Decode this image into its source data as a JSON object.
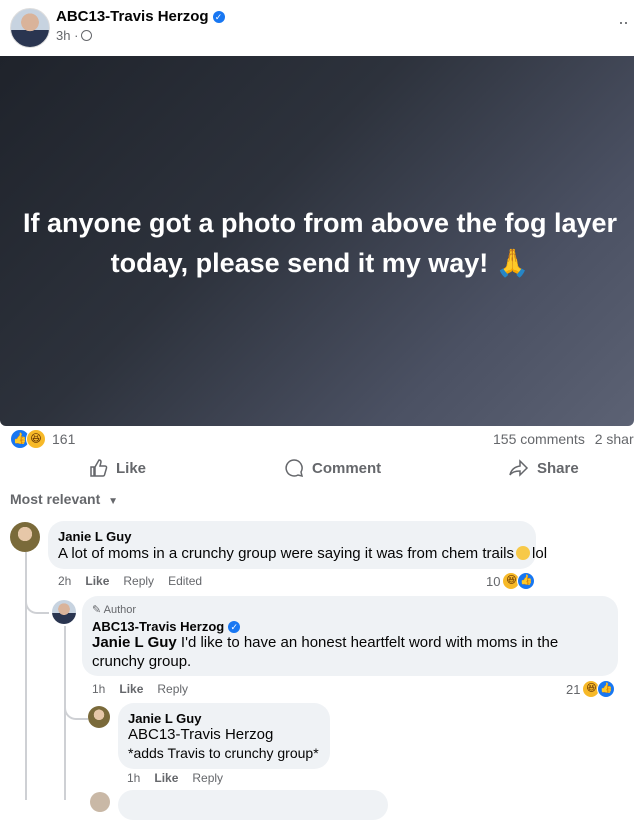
{
  "post": {
    "page_name": "ABC13-Travis Herzog",
    "time": "3h",
    "separator": "·",
    "hero_text": "If anyone got a photo from above the fog layer today, please send it my way! 🙏",
    "reaction_count": "161",
    "comments_label": "155 comments",
    "shares_label": "2 shar"
  },
  "actions": {
    "like": "Like",
    "comment": "Comment",
    "share": "Share"
  },
  "sort_label": "Most relevant",
  "comments": [
    {
      "name": "Janie L Guy",
      "text": "A lot of moms in a crunchy group were saying it was from chem trails",
      "text_after": "lol",
      "time": "2h",
      "like": "Like",
      "reply": "Reply",
      "edited": "Edited",
      "reactions": "10"
    },
    {
      "author_badge": "Author",
      "name": "ABC13-Travis Herzog",
      "mention": "Janie L Guy",
      "text": " I'd like to have an honest heartfelt word with moms in the crunchy group.",
      "time": "1h",
      "like": "Like",
      "reply": "Reply",
      "reactions": "21"
    },
    {
      "name": "Janie L Guy",
      "mention": "ABC13-Travis Herzog",
      "text": "*adds Travis to crunchy group*",
      "time": "1h",
      "like": "Like",
      "reply": "Reply"
    }
  ],
  "colors": {
    "accent": "#1877f2",
    "bubble": "#eff2f5",
    "muted": "#65676b"
  }
}
